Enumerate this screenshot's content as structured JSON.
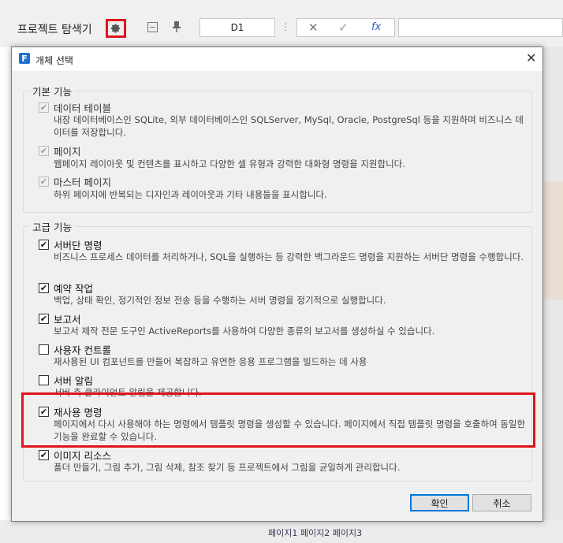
{
  "toolbar": {
    "explorer_title": "프로젝트 탐색기",
    "cell_ref": "D1",
    "vertical_dots": "⋮",
    "cancel_glyph": "✕",
    "confirm_glyph": "✓",
    "fx_label": "fx",
    "icons": [
      "gear-icon",
      "collapse-icon",
      "pin-icon",
      "cancel-icon",
      "check-icon",
      "function-icon"
    ]
  },
  "dialog": {
    "logo_letter": "F",
    "title": "개체 선택",
    "close_glyph": "✕",
    "basic_group": {
      "label": "기본 기능",
      "items": [
        {
          "title": "데이터 테이블",
          "desc": "내장 데이터베이스인 SQLite, 외부 데이터베이스인 SQLServer, MySql, Oracle, PostgreSql 등을 지원하며 비즈니스 데이터를 저장합니다.",
          "checked": true,
          "enabled": false
        },
        {
          "title": "페이지",
          "desc": "웹페이지 레이아웃 및 컨텐츠를 표시하고 다양한 셀 유형과 강력한 대화형 명령을 지원합니다.",
          "checked": true,
          "enabled": false
        },
        {
          "title": "마스터 페이지",
          "desc": "하위 페이지에 반복되는 디자인과 레이아웃과 기타 내용들을 표시합니다.",
          "checked": true,
          "enabled": false
        }
      ]
    },
    "advanced_group": {
      "label": "고급 기능",
      "items": [
        {
          "title": "서버단 명령",
          "desc": "비즈니스 프로세스 데이터를 처리하거나, SQL을 실행하는 등 강력한 백그라운드 명령을 지원하는 서버단 명령을 수행합니다.",
          "checked": true,
          "enabled": true
        },
        {
          "title": "예약 작업",
          "desc": "백업, 상태 확인, 정기적인 정보 전송 등을 수행하는 서버 명령을 정기적으로 실행합니다.",
          "checked": true,
          "enabled": true
        },
        {
          "title": "보고서",
          "desc": "보고서 제작 전문 도구인 ActiveReports를 사용하여 다양한 종류의 보고서를 생성하실 수 있습니다.",
          "checked": true,
          "enabled": true
        },
        {
          "title": "사용자 컨트롤",
          "desc": "재사용된 UI 컴포넌트를 만들어 복잡하고 유연한 응용 프로그램을 빌드하는 데 사용",
          "checked": false,
          "enabled": true
        },
        {
          "title": "서버 알림",
          "desc": "서버 측 클라이언트 알림을 제공합니다.",
          "checked": false,
          "enabled": true
        },
        {
          "title": "재사용 명령",
          "desc": "페이지에서 다시 사용해야 하는 명령에서 템플릿 명령을 생성할 수 있습니다. 페이지에서 직접 템플릿 명령을 호출하여 동일한 기능을 완료할 수 있습니다.",
          "checked": true,
          "enabled": true
        },
        {
          "title": "이미지 리소스",
          "desc": "폴더 만들기, 그림 추가, 그림 삭제, 참조 찾기 등 프로젝트에서 그림을 균일하게 관리합니다.",
          "checked": true,
          "enabled": true
        }
      ]
    },
    "ok_label": "확인",
    "cancel_label": "취소",
    "check_glyph": "✔"
  },
  "background": {
    "sheet_tabs": "페이지1    페이지2    페이지3"
  },
  "colors": {
    "highlight": "#e0141b",
    "logo": "#1e6fd0",
    "primary_border": "#0078d7"
  }
}
